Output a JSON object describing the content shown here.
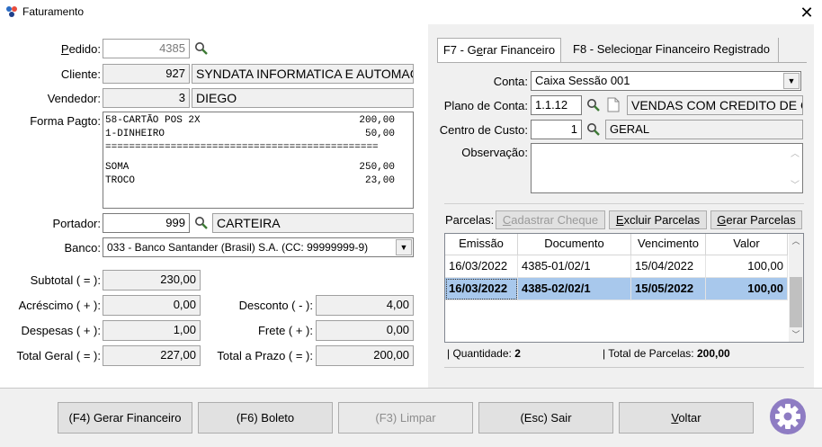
{
  "window": {
    "title": "Faturamento",
    "close_glyph": "✕",
    "icon": "app-logo-icon"
  },
  "form": {
    "pedido": {
      "label": "Pedido:",
      "value": "4385"
    },
    "cliente": {
      "label": "Cliente:",
      "code": "927",
      "name": "SYNDATA INFORMATICA E AUTOMACAO"
    },
    "vendedor": {
      "label": "Vendedor:",
      "code": "3",
      "name": "DIEGO"
    },
    "forma_pagto": {
      "label": "Forma Pagto:",
      "lines": [
        {
          "desc": "58-CARTÃO POS 2X",
          "amount": "200,00"
        },
        {
          "desc": "1-DINHEIRO",
          "amount": "50,00"
        },
        {
          "desc": "==============================================",
          "amount": ""
        },
        {
          "desc": "SOMA",
          "amount": "250,00"
        },
        {
          "desc": "TROCO",
          "amount": "23,00"
        }
      ]
    },
    "portador": {
      "label": "Portador:",
      "code": "999",
      "name": "CARTEIRA"
    },
    "banco": {
      "label": "Banco:",
      "value": "033 - Banco Santander (Brasil) S.A. (CC: 99999999-9)"
    },
    "subtotal": {
      "label": "Subtotal ( = ):",
      "value": "230,00"
    },
    "acrescimo": {
      "label": "Acréscimo ( + ):",
      "value": "0,00"
    },
    "desconto": {
      "label": "Desconto ( - ):",
      "value": "4,00"
    },
    "despesas": {
      "label": "Despesas ( + ):",
      "value": "1,00"
    },
    "frete": {
      "label": "Frete ( + ):",
      "value": "0,00"
    },
    "total_geral": {
      "label": "Total Geral ( = ):",
      "value": "227,00"
    },
    "total_prazo": {
      "label": "Total a Prazo ( = ):",
      "value": "200,00"
    }
  },
  "tabs": [
    {
      "pre": "F7 - G",
      "ul": "e",
      "post": "rar Financeiro",
      "active": true
    },
    {
      "pre": "F8 - Selecio",
      "ul": "n",
      "post": "ar Financeiro Registrado",
      "active": false
    }
  ],
  "financeiro": {
    "conta": {
      "label": "Conta:",
      "value": "Caixa Sessão 001"
    },
    "plano": {
      "label": "Plano de Conta:",
      "code": "1.1.12",
      "name": "VENDAS COM CREDITO DE CLIENTE"
    },
    "centro": {
      "label": "Centro de Custo:",
      "code": "1",
      "name": "GERAL"
    },
    "observacao": {
      "label": "Observação:",
      "value": ""
    }
  },
  "parcelas": {
    "label": "Parcelas:",
    "buttons": {
      "cadastrar": {
        "ul": "C",
        "rest": "adastrar Cheque"
      },
      "excluir": {
        "ul": "E",
        "rest": "xcluir Parcelas"
      },
      "gerar": {
        "ul": "G",
        "rest": "erar Parcelas"
      }
    },
    "columns": [
      "Emissão",
      "Documento",
      "Vencimento",
      "Valor"
    ],
    "rows": [
      {
        "emissao": "16/03/2022",
        "documento": "4385-01/02/1",
        "vencimento": "15/04/2022",
        "valor": "100,00",
        "selected": false
      },
      {
        "emissao": "16/03/2022",
        "documento": "4385-02/02/1",
        "vencimento": "15/05/2022",
        "valor": "100,00",
        "selected": true
      }
    ],
    "quantidade_label": "| Quantidade:",
    "quantidade_value": "2",
    "total_label": "| Total de Parcelas:",
    "total_value": "200,00"
  },
  "footer": {
    "gerar": "(F4) Gerar Financeiro",
    "boleto": "(F6) Boleto",
    "limpar": "(F3) Limpar",
    "sair": "(Esc) Sair",
    "voltar_ul": "V",
    "voltar_rest": "oltar"
  },
  "colors": {
    "accent": "#8e7cc3",
    "selected_row": "#a8c8ec"
  }
}
